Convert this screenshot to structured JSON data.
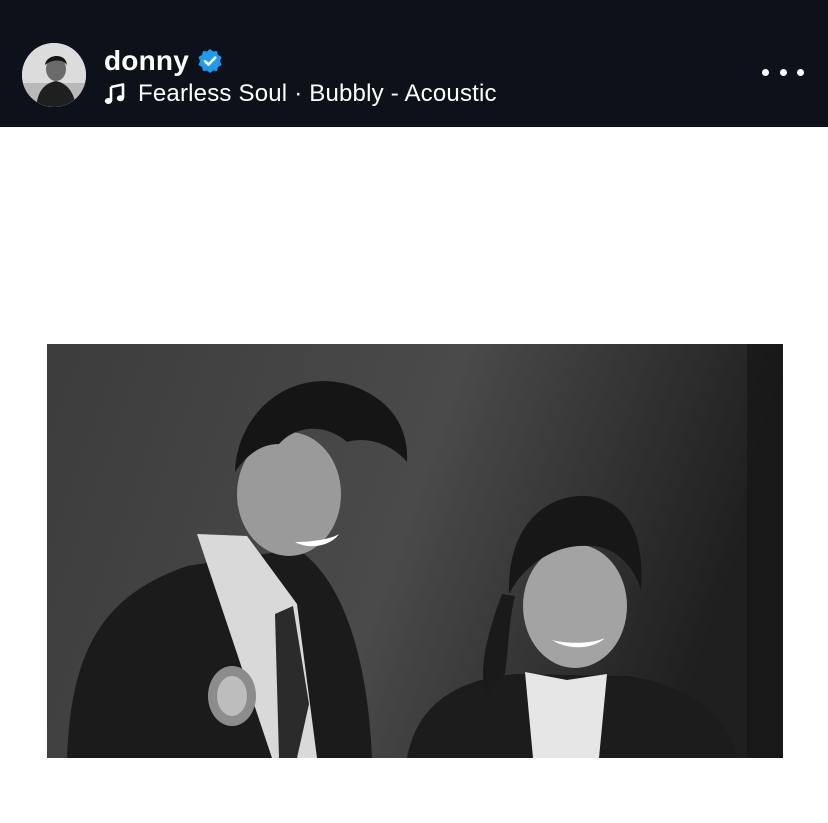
{
  "post": {
    "username": "donny",
    "verified": true,
    "music": {
      "text": "Fearless Soul · Bubbly - Acoustic"
    }
  },
  "icons": {
    "verified": "verified-badge-icon",
    "music": "music-note-icon",
    "more": "more-options-icon"
  },
  "colors": {
    "header_background": "#0d121a",
    "verified_blue": "#1d9bf0",
    "text": "#ffffff",
    "page_background": "#ffffff"
  },
  "media": {
    "description_style": "black-and-white photo"
  }
}
